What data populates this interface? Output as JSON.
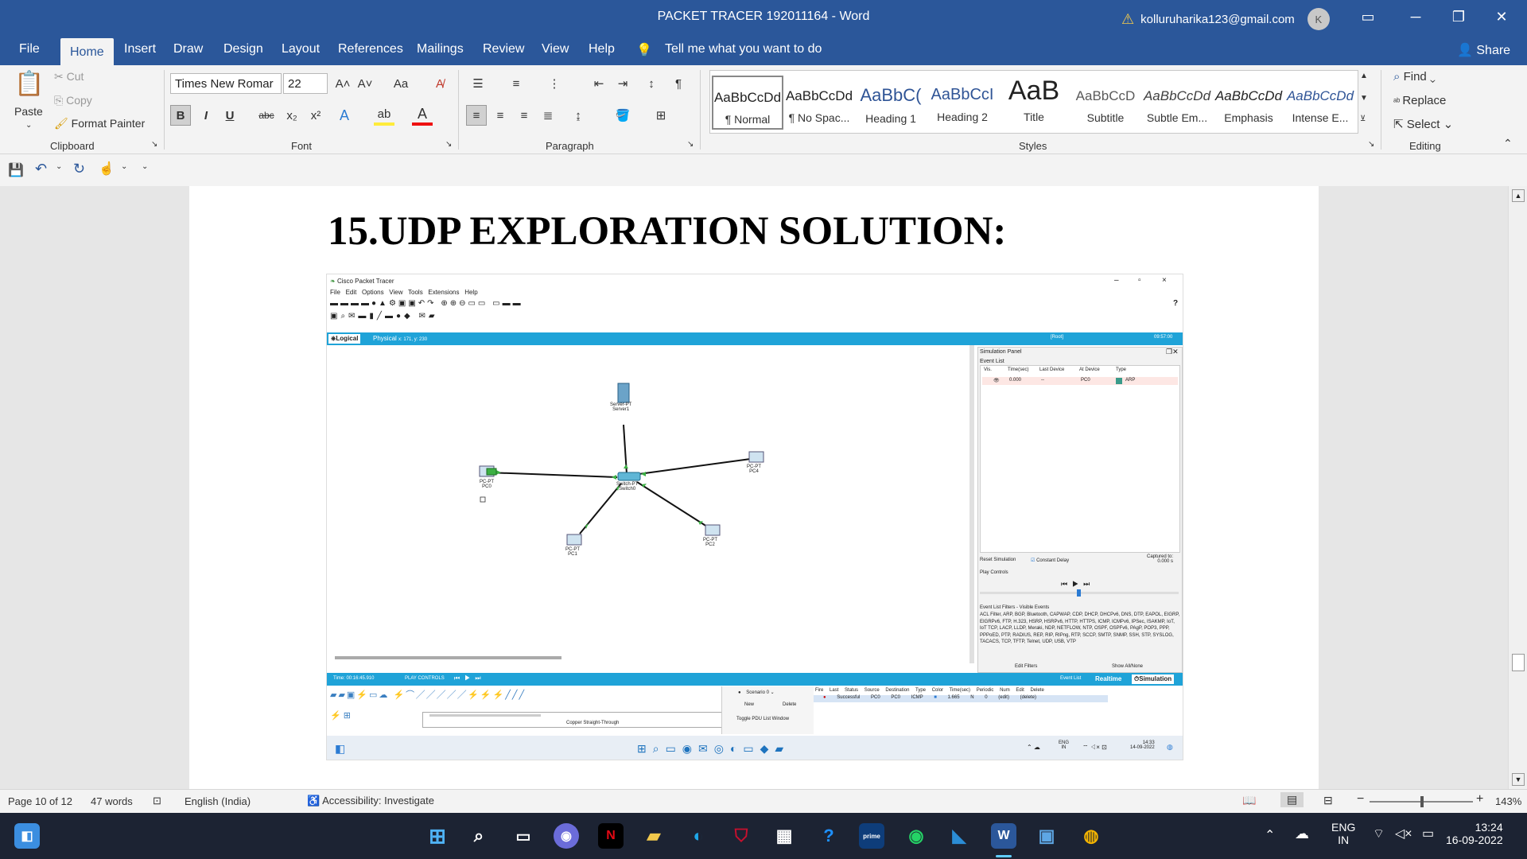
{
  "window": {
    "title": "PACKET TRACER 192011164  -  Word",
    "account_email": "kolluruharika123@gmail.com",
    "avatar_initial": "K"
  },
  "tabs": [
    "File",
    "Home",
    "Insert",
    "Draw",
    "Design",
    "Layout",
    "References",
    "Mailings",
    "Review",
    "View",
    "Help"
  ],
  "tell_me": "Tell me what you want to do",
  "share": "Share",
  "clipboard": {
    "paste": "Paste",
    "cut": "Cut",
    "copy": "Copy",
    "format_painter": "Format Painter",
    "label": "Clipboard"
  },
  "font": {
    "name": "Times New Romar",
    "size": "22",
    "label": "Font",
    "bold": "B",
    "italic": "I",
    "underline": "U",
    "strike": "abc",
    "sub": "x₂",
    "sup": "x²",
    "case": "Aa"
  },
  "paragraph": {
    "label": "Paragraph"
  },
  "styles": {
    "label": "Styles",
    "items": [
      {
        "preview": "AaBbCcDd",
        "name": "¶ Normal"
      },
      {
        "preview": "AaBbCcDd",
        "name": "¶ No Spac..."
      },
      {
        "preview": "AaBbC(",
        "name": "Heading 1"
      },
      {
        "preview": "AaBbCcI",
        "name": "Heading 2"
      },
      {
        "preview": "AaB",
        "name": "Title"
      },
      {
        "preview": "AaBbCcD",
        "name": "Subtitle"
      },
      {
        "preview": "AaBbCcDd",
        "name": "Subtle Em..."
      },
      {
        "preview": "AaBbCcDd",
        "name": "Emphasis"
      },
      {
        "preview": "AaBbCcDd",
        "name": "Intense E..."
      }
    ]
  },
  "editing": {
    "find": "Find",
    "replace": "Replace",
    "select": "Select",
    "label": "Editing"
  },
  "document": {
    "heading": "15.UDP EXPLORATION SOLUTION:"
  },
  "packet_tracer": {
    "title": "Cisco Packet Tracer",
    "menu": [
      "File",
      "Edit",
      "Options",
      "View",
      "Tools",
      "Extensions",
      "Help"
    ],
    "tab_logical": "Logical",
    "tab_physical": "Physical",
    "coords": "x: 171, y: 230",
    "root": "[Root]",
    "clock": "09:57:00",
    "devices": [
      {
        "type": "Server-PT",
        "name": "Server1"
      },
      {
        "type": "PC-PT",
        "name": "PC0"
      },
      {
        "type": "Switch-PT",
        "name": "Switch0"
      },
      {
        "type": "PC-PT",
        "name": "PC4"
      },
      {
        "type": "PC-PT",
        "name": "PC2"
      },
      {
        "type": "PC-PT",
        "name": "PC1"
      }
    ],
    "sim_panel": {
      "title": "Simulation Panel",
      "event_list": "Event List",
      "columns": [
        "Vis.",
        "Time(sec)",
        "Last Device",
        "At Device",
        "Type"
      ],
      "row": [
        "0.000",
        "--",
        "PC0",
        "ARP"
      ],
      "reset": "Reset Simulation",
      "constant_delay": "Constant Delay",
      "captured": "Captured to:",
      "captured_val": "0.000 s",
      "play_controls": "Play Controls",
      "filters_title": "Event List Filters - Visible Events",
      "filters": "ACL Filter, ARP, BGP, Bluetooth, CAPWAP, CDP, DHCP, DHCPv6, DNS, DTP, EAPOL, EIGRP, EIGRPv6, FTP, H.323, HSRP, HSRPv6, HTTP, HTTPS, ICMP, ICMPv6, IPSec, ISAKMP, IoT, IoT TCP, LACP, LLDP, Meraki, NDP, NETFLOW, NTP, OSPF, OSPFv6, PAgP, POP3, PPP, PPPoED, PTP, RADIUS, REP, RIP, RIPng, RTP, SCCP, SMTP, SNMP, SSH, STP, SYSLOG, TACACS, TCP, TFTP, Telnet, UDP, USB, VTP",
      "edit_filters": "Edit Filters",
      "show_all": "Show All/None"
    },
    "time": "Time: 00:16:45.910",
    "play_controls": "PLAY CONTROLS",
    "event_list_btn": "Event List",
    "realtime": "Realtime",
    "simulation": "Simulation",
    "scenario": "Scenario 0",
    "new": "New",
    "delete": "Delete",
    "toggle": "Toggle PDU List Window",
    "cable": "Copper Straight-Through",
    "pdu_cols": [
      "Fire",
      "Last Status",
      "Source",
      "Destination",
      "Type",
      "Color",
      "Time(sec)",
      "Periodic",
      "Num",
      "Edit",
      "Delete"
    ],
    "pdu_row": [
      "Successful",
      "PC0",
      "PC0",
      "ICMP",
      "1.665",
      "N",
      "0",
      "(edit)",
      "(delete)"
    ],
    "tray_lang": "ENG",
    "tray_region": "IN",
    "tray_time": "14:33",
    "tray_date": "14-09-2022"
  },
  "status": {
    "page": "Page 10 of 12",
    "words": "47 words",
    "lang": "English (India)",
    "access": "Accessibility: Investigate",
    "zoom": "143%"
  },
  "taskbar": {
    "lang": "ENG",
    "region": "IN",
    "time": "13:24",
    "date": "16-09-2022"
  }
}
